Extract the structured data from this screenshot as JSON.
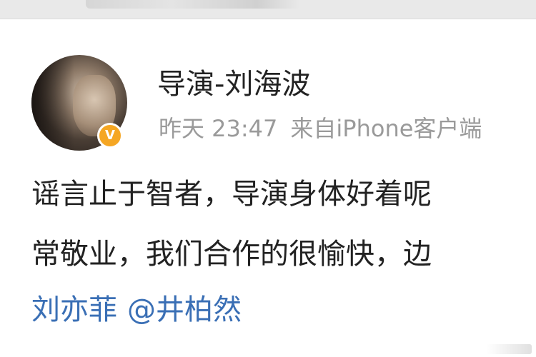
{
  "post": {
    "author_name": "导演-刘海波",
    "verified_mark": "V",
    "time": "昨天 23:47",
    "source": "来自iPhone客户端",
    "text_line1": "谣言止于智者，导演身体好着呢",
    "text_line2": "常敬业，我们合作的很愉快，边",
    "mentions": [
      "刘亦菲",
      "@井柏然"
    ]
  },
  "colors": {
    "link": "#3a6fb5",
    "badge": "#f5a623",
    "meta": "#9a9a9a",
    "text": "#222222"
  }
}
